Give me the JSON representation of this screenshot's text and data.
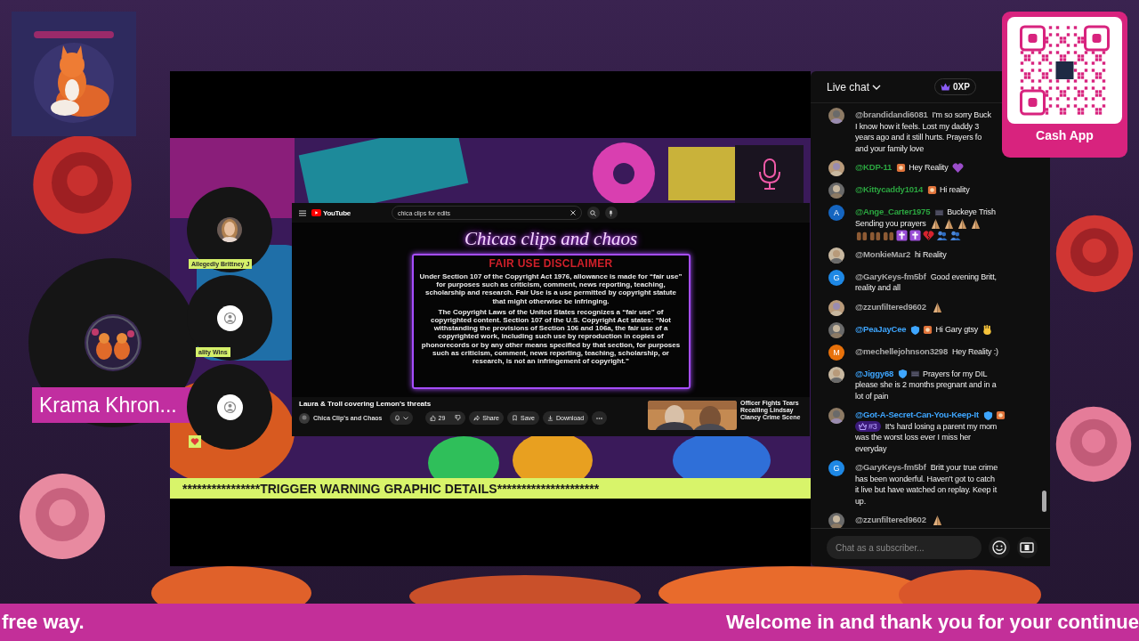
{
  "logo": {
    "kind": "picture"
  },
  "stage": {
    "banner": "****************TRIGGER WARNING GRAPHIC DETAILS*********************",
    "browser": {
      "site": "YouTube",
      "search": "chica clips for edits",
      "video_heading": "Chicas clips and chaos",
      "disclaimer_title": "FAIR USE DISCLAIMER",
      "disclaimer": [
        "Under Section 107 of the Copyright Act 1976, allowance is made for “fair use” for purposes such as criticism, comment, news reporting,  teaching, scholarship and research. Fair Use is a use permitted by copyright statute that might otherwise be infringing.",
        "The Copyright Laws of the United States recognizes a “fair use” of copyrighted content. Section 107 of the U.S. Copyright Act states: “Not withstanding the provisions of Section 106 and 106a, the fair use of a copyrighted work, including such use by reproduction in copies of phonorecords or by any other means specified by that section, for purposes such as criticism, comment, news reporting, teaching, scholarship, or research, is not an infringement of copyright.”"
      ],
      "title": "Laura & Troll covering Lemon's threats",
      "channel": "Chica Clip's and Chaos",
      "likes": "29",
      "actions": [
        {
          "kind": "share",
          "label": "Share"
        },
        {
          "kind": "save",
          "label": "Save"
        },
        {
          "kind": "download",
          "label": "Download"
        }
      ],
      "up_next": "Officer Fights Tears Recalling Lindsay Clancy Crime Scene"
    }
  },
  "speakers": [
    {
      "kind": "host",
      "name": "Krama Khron..."
    },
    {
      "kind": "guest",
      "avatar": {
        "kind": "picture"
      },
      "name": "Allegedly Brittney J"
    },
    {
      "kind": "guest",
      "avatar": {
        "kind": "default"
      },
      "name": "ality Wins"
    },
    {
      "kind": "guest",
      "avatar": {
        "kind": "default"
      },
      "reacting": true
    }
  ],
  "chat": {
    "title": "Live chat",
    "points": "0XP",
    "placeholder": "Chat as a subscriber...",
    "messages": [
      {
        "author": "@brandidandi6081",
        "color": "#aaaaaa",
        "avatar": {
          "kind": "picture"
        },
        "text": "I'm so sorry Buck",
        "more_lines": [
          {
            "text": "I know how it feels. Lost my daddy 3"
          },
          {
            "text": "years ago and it still hurts. Prayers fo"
          },
          {
            "text": "and your family love"
          }
        ]
      },
      {
        "author": "@KDP-11",
        "color": "#2ba640",
        "avatar": {
          "kind": "picture"
        },
        "badges": [
          {
            "kind": "sticker"
          }
        ],
        "text": "Hey Reality",
        "emojis": [
          {
            "kind": "purple-heart"
          }
        ]
      },
      {
        "author": "@Kittycaddy1014",
        "color": "#2ba640",
        "avatar": {
          "kind": "picture"
        },
        "badges": [
          {
            "kind": "sticker"
          }
        ],
        "text": "Hi reality"
      },
      {
        "author": "@Ange_Carter1975",
        "color": "#2ba640",
        "avatar": {
          "kind": "letter",
          "letter": "A",
          "color": "#1565c0"
        },
        "badges": [
          {
            "kind": "member"
          }
        ],
        "text": "Buckeye Trish",
        "more_lines": [
          {
            "text": "Sending you prayers",
            "emojis": [
              {
                "kind": "pray"
              },
              {
                "kind": "pray"
              },
              {
                "kind": "pray"
              },
              {
                "kind": "pray"
              }
            ]
          },
          {
            "emojis": [
              {
                "kind": "raised-hands"
              },
              {
                "kind": "raised-hands"
              },
              {
                "kind": "raised-hands"
              },
              {
                "kind": "cross"
              },
              {
                "kind": "cross"
              },
              {
                "kind": "broken-heart"
              },
              {
                "kind": "people"
              },
              {
                "kind": "people"
              }
            ]
          }
        ]
      },
      {
        "author": "@MonkieMar2",
        "color": "#aaaaaa",
        "avatar": {
          "kind": "picture"
        },
        "text": "hi Reality"
      },
      {
        "author": "@GaryKeys-fm5bf",
        "color": "#aaaaaa",
        "avatar": {
          "kind": "letter",
          "letter": "G",
          "color": "#1e88e5"
        },
        "text": "Good evening Britt,",
        "more_lines": [
          {
            "text": "reality and all"
          }
        ]
      },
      {
        "author": "@zzunfiltered9602",
        "color": "#aaaaaa",
        "avatar": {
          "kind": "picture"
        },
        "emojis": [
          {
            "kind": "pray"
          }
        ]
      },
      {
        "author": "@PeaJayCee",
        "color": "#3ea6ff",
        "avatar": {
          "kind": "picture"
        },
        "badges": [
          {
            "kind": "shield"
          },
          {
            "kind": "sticker"
          }
        ],
        "text": "Hi Gary gtsy",
        "emojis": [
          {
            "kind": "wave"
          }
        ]
      },
      {
        "author": "@mechellejohnson3298",
        "color": "#aaaaaa",
        "avatar": {
          "kind": "letter",
          "letter": "M",
          "color": "#e8710a"
        },
        "text": "Hey Reality :)"
      },
      {
        "author": "@Jiggy68",
        "color": "#3ea6ff",
        "avatar": {
          "kind": "picture"
        },
        "badges": [
          {
            "kind": "shield"
          },
          {
            "kind": "member"
          }
        ],
        "text": "Prayers for my DIL",
        "more_lines": [
          {
            "text": "please she is 2 months pregnant and in a"
          },
          {
            "text": "lot of pain"
          }
        ]
      },
      {
        "author": "@Got-A-Secret-Can-You-Keep-It",
        "color": "#3ea6ff",
        "avatar": {
          "kind": "picture"
        },
        "badges": [
          {
            "kind": "shield"
          },
          {
            "kind": "sticker"
          }
        ],
        "rank": "#3",
        "more_lines": [
          {
            "text": "It's hard losing a parent my mom"
          },
          {
            "text": "was the worst loss ever I miss her"
          },
          {
            "text": "everyday"
          }
        ]
      },
      {
        "author": "@GaryKeys-fm5bf",
        "color": "#aaaaaa",
        "avatar": {
          "kind": "letter",
          "letter": "G",
          "color": "#1e88e5"
        },
        "text": "Britt your true crime",
        "more_lines": [
          {
            "text": "has been wonderful. Haven't got to catch"
          },
          {
            "text": "it live but have watched on replay. Keep it"
          },
          {
            "text": "up."
          }
        ]
      },
      {
        "author": "@zzunfiltered9602",
        "color": "#aaaaaa",
        "avatar": {
          "kind": "picture"
        },
        "emojis": [
          {
            "kind": "pray"
          }
        ]
      }
    ]
  },
  "donation": {
    "label": "Cash App"
  },
  "ticker": [
    "free way.",
    "Welcome in and thank you for your continue"
  ]
}
